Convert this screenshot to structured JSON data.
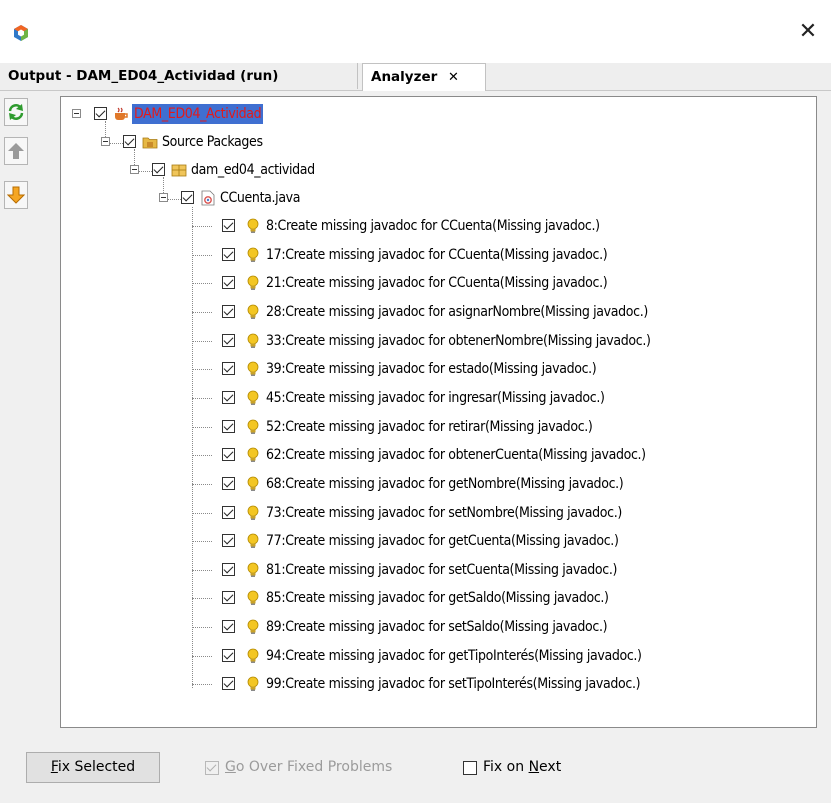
{
  "window": {
    "close_glyph": "✕"
  },
  "tabs": [
    {
      "label": "Output - DAM_ED04_Actividad (run)",
      "closable": false
    },
    {
      "label": "Analyzer",
      "closable": true,
      "close_glyph": "✕"
    }
  ],
  "side_buttons": [
    {
      "icon": "refresh-icon",
      "color": "#2e9b2e"
    },
    {
      "icon": "arrow-up-icon",
      "color": "#8a8a8a"
    },
    {
      "icon": "arrow-down-icon",
      "color": "#e08a16"
    }
  ],
  "tree": {
    "project": {
      "label": "DAM_ED04_Actividad",
      "icon": "coffee-cup-icon",
      "selected": true
    },
    "source_packages": {
      "label": "Source Packages",
      "icon": "folder-icon"
    },
    "package": {
      "label": "dam_ed04_actividad",
      "icon": "package-icon"
    },
    "file": {
      "label": "CCuenta.java",
      "icon": "java-file-icon"
    },
    "items": [
      {
        "label": "8:Create missing javadoc for CCuenta(Missing javadoc.)"
      },
      {
        "label": "17:Create missing javadoc for CCuenta(Missing javadoc.)"
      },
      {
        "label": "21:Create missing javadoc for CCuenta(Missing javadoc.)"
      },
      {
        "label": "28:Create missing javadoc for asignarNombre(Missing javadoc.)"
      },
      {
        "label": "33:Create missing javadoc for obtenerNombre(Missing javadoc.)"
      },
      {
        "label": "39:Create missing javadoc for estado(Missing javadoc.)"
      },
      {
        "label": "45:Create missing javadoc for ingresar(Missing javadoc.)"
      },
      {
        "label": "52:Create missing javadoc for retirar(Missing javadoc.)"
      },
      {
        "label": "62:Create missing javadoc for obtenerCuenta(Missing javadoc.)"
      },
      {
        "label": "68:Create missing javadoc for getNombre(Missing javadoc.)"
      },
      {
        "label": "73:Create missing javadoc for setNombre(Missing javadoc.)"
      },
      {
        "label": "77:Create missing javadoc for getCuenta(Missing javadoc.)"
      },
      {
        "label": "81:Create missing javadoc for setCuenta(Missing javadoc.)"
      },
      {
        "label": "85:Create missing javadoc for getSaldo(Missing javadoc.)"
      },
      {
        "label": "89:Create missing javadoc for setSaldo(Missing javadoc.)"
      },
      {
        "label": "94:Create missing javadoc for getTipoInterés(Missing javadoc.)"
      },
      {
        "label": "99:Create missing javadoc for setTipoInterés(Missing javadoc.)"
      }
    ]
  },
  "bottom": {
    "fix_selected": {
      "mnemonic": "F",
      "rest": "ix Selected"
    },
    "go_over_fixed": {
      "mnemonic": "G",
      "rest": "o Over Fixed Problems",
      "checked": true,
      "enabled": false
    },
    "fix_on_next": {
      "before": "Fix on ",
      "mnemonic": "N",
      "rest": "ext",
      "checked": false
    }
  },
  "colors": {
    "selection": "#3f6fd1",
    "project_text": "#e31a1a",
    "bulb": "#f3c623"
  }
}
